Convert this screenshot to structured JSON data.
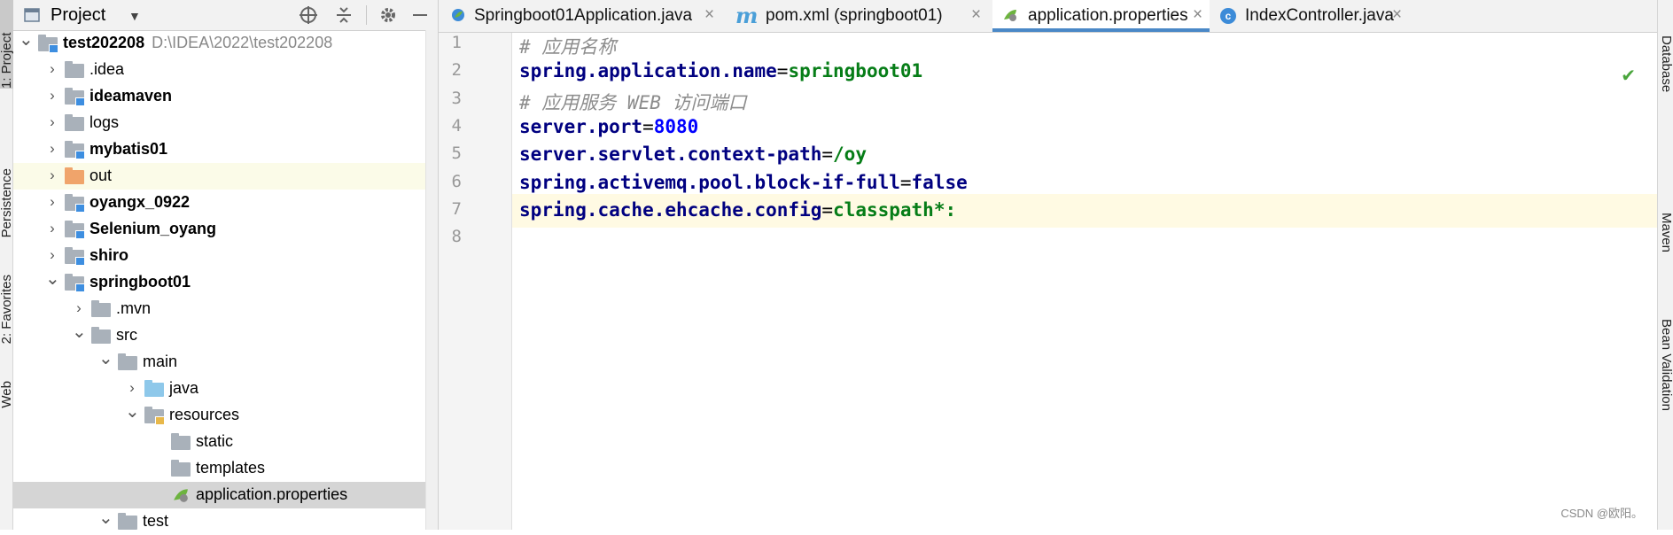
{
  "left_toolstrip": {
    "tabs": [
      {
        "label": "1: Project",
        "active": true
      },
      {
        "label": "Persistence",
        "active": false
      },
      {
        "label": "2: Favorites",
        "active": false
      },
      {
        "label": "Web",
        "active": false
      }
    ]
  },
  "right_toolstrip": {
    "tabs": [
      {
        "label": "Database"
      },
      {
        "label": "Maven"
      },
      {
        "label": "Bean Validation"
      }
    ]
  },
  "project_panel": {
    "title": "Project",
    "icons": [
      "project-window-icon",
      "chevron-down-icon",
      "target-icon",
      "collapse-all-icon",
      "gear-icon",
      "minimize-icon"
    ]
  },
  "tree": [
    {
      "label": "test202208",
      "path": "D:\\IDEA\\2022\\test202208",
      "depth": 0,
      "expanded": true,
      "bold": true,
      "folder": "module"
    },
    {
      "label": ".idea",
      "depth": 1,
      "expanded": false,
      "bold": false,
      "folder": "plain"
    },
    {
      "label": "ideamaven",
      "depth": 1,
      "expanded": false,
      "bold": true,
      "folder": "module"
    },
    {
      "label": "logs",
      "depth": 1,
      "expanded": false,
      "bold": false,
      "folder": "plain"
    },
    {
      "label": "mybatis01",
      "depth": 1,
      "expanded": false,
      "bold": true,
      "folder": "module"
    },
    {
      "label": "out",
      "depth": 1,
      "expanded": false,
      "bold": false,
      "folder": "excluded",
      "highlight": "soft"
    },
    {
      "label": "oyangx_0922",
      "depth": 1,
      "expanded": false,
      "bold": true,
      "folder": "module"
    },
    {
      "label": "Selenium_oyang",
      "depth": 1,
      "expanded": false,
      "bold": true,
      "folder": "module"
    },
    {
      "label": "shiro",
      "depth": 1,
      "expanded": false,
      "bold": true,
      "folder": "module"
    },
    {
      "label": "springboot01",
      "depth": 1,
      "expanded": true,
      "bold": true,
      "folder": "module"
    },
    {
      "label": ".mvn",
      "depth": 2,
      "expanded": false,
      "bold": false,
      "folder": "plain"
    },
    {
      "label": "src",
      "depth": 2,
      "expanded": true,
      "bold": false,
      "folder": "plain"
    },
    {
      "label": "main",
      "depth": 3,
      "expanded": true,
      "bold": false,
      "folder": "plain"
    },
    {
      "label": "java",
      "depth": 4,
      "expanded": false,
      "bold": false,
      "folder": "source"
    },
    {
      "label": "resources",
      "depth": 4,
      "expanded": true,
      "bold": false,
      "folder": "resources"
    },
    {
      "label": "static",
      "depth": 5,
      "expanded": null,
      "bold": false,
      "folder": "plain"
    },
    {
      "label": "templates",
      "depth": 5,
      "expanded": null,
      "bold": false,
      "folder": "plain"
    },
    {
      "label": "application.properties",
      "depth": 5,
      "expanded": null,
      "bold": false,
      "folder": "file",
      "highlight": "selected"
    },
    {
      "label": "test",
      "depth": 3,
      "expanded": true,
      "bold": false,
      "folder": "plain"
    }
  ],
  "tabs": [
    {
      "label": "Springboot01Application.java",
      "icon": "spring-class-icon",
      "active": false
    },
    {
      "label": "pom.xml (springboot01)",
      "icon": "maven-icon",
      "active": false
    },
    {
      "label": "application.properties",
      "icon": "spring-properties-icon",
      "active": true
    },
    {
      "label": "IndexController.java",
      "icon": "class-icon",
      "active": false
    }
  ],
  "close_glyph": "×",
  "editor": {
    "current_line": 7,
    "lines": [
      {
        "num": "1",
        "parts": [
          {
            "t": "# 应用名称",
            "c": "cm"
          }
        ]
      },
      {
        "num": "2",
        "parts": [
          {
            "t": "spring.application.name",
            "c": "k"
          },
          {
            "t": "=",
            "c": "eq"
          },
          {
            "t": "springboot01",
            "c": "v"
          }
        ]
      },
      {
        "num": "3",
        "parts": [
          {
            "t": "# 应用服务 WEB 访问端口",
            "c": "cm"
          }
        ]
      },
      {
        "num": "4",
        "parts": [
          {
            "t": "server.port",
            "c": "k"
          },
          {
            "t": "=",
            "c": "eq"
          },
          {
            "t": "8080",
            "c": "n"
          }
        ]
      },
      {
        "num": "5",
        "parts": [
          {
            "t": "server.servlet.context-path",
            "c": "k"
          },
          {
            "t": "=",
            "c": "eq"
          },
          {
            "t": "/oy",
            "c": "v"
          }
        ]
      },
      {
        "num": "6",
        "parts": [
          {
            "t": "spring.activemq.pool.block-if-full",
            "c": "k"
          },
          {
            "t": "=",
            "c": "eq"
          },
          {
            "t": "false",
            "c": "b"
          }
        ]
      },
      {
        "num": "7",
        "parts": [
          {
            "t": "spring.cache.ehcache.config",
            "c": "k"
          },
          {
            "t": "=",
            "c": "eq"
          },
          {
            "t": "classpath*:",
            "c": "v"
          }
        ]
      },
      {
        "num": "8",
        "parts": []
      }
    ]
  },
  "status_check": "✔",
  "watermark": "CSDN @欧阳。",
  "colors": {
    "key": "#000080",
    "value": "#067d17",
    "number": "#0000ff",
    "comment": "#8c8c8c",
    "active_tab_underline": "#4a88c7",
    "current_line_bg": "#fffae3",
    "selected_row_bg": "#d5d5d5"
  }
}
